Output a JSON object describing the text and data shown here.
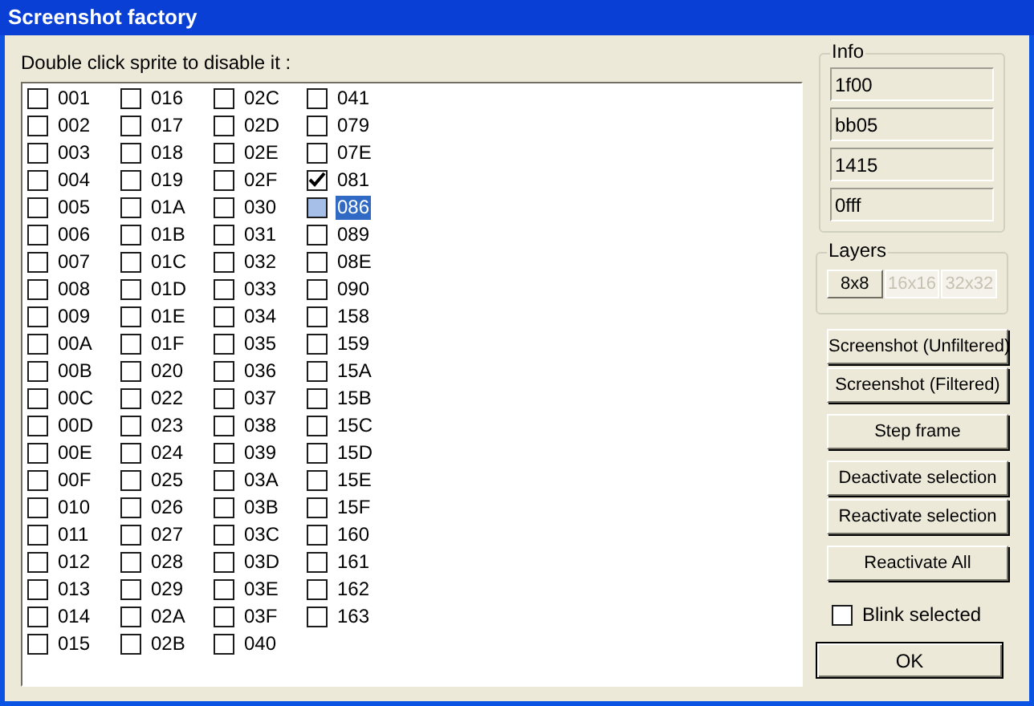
{
  "window": {
    "title": "Screenshot factory"
  },
  "instruction": "Double click sprite to disable it :",
  "sprites": [
    {
      "label": "001",
      "checked": false,
      "selected": false
    },
    {
      "label": "002",
      "checked": false,
      "selected": false
    },
    {
      "label": "003",
      "checked": false,
      "selected": false
    },
    {
      "label": "004",
      "checked": false,
      "selected": false
    },
    {
      "label": "005",
      "checked": false,
      "selected": false
    },
    {
      "label": "006",
      "checked": false,
      "selected": false
    },
    {
      "label": "007",
      "checked": false,
      "selected": false
    },
    {
      "label": "008",
      "checked": false,
      "selected": false
    },
    {
      "label": "009",
      "checked": false,
      "selected": false
    },
    {
      "label": "00A",
      "checked": false,
      "selected": false
    },
    {
      "label": "00B",
      "checked": false,
      "selected": false
    },
    {
      "label": "00C",
      "checked": false,
      "selected": false
    },
    {
      "label": "00D",
      "checked": false,
      "selected": false
    },
    {
      "label": "00E",
      "checked": false,
      "selected": false
    },
    {
      "label": "00F",
      "checked": false,
      "selected": false
    },
    {
      "label": "010",
      "checked": false,
      "selected": false
    },
    {
      "label": "011",
      "checked": false,
      "selected": false
    },
    {
      "label": "012",
      "checked": false,
      "selected": false
    },
    {
      "label": "013",
      "checked": false,
      "selected": false
    },
    {
      "label": "014",
      "checked": false,
      "selected": false
    },
    {
      "label": "015",
      "checked": false,
      "selected": false
    },
    {
      "label": "016",
      "checked": false,
      "selected": false
    },
    {
      "label": "017",
      "checked": false,
      "selected": false
    },
    {
      "label": "018",
      "checked": false,
      "selected": false
    },
    {
      "label": "019",
      "checked": false,
      "selected": false
    },
    {
      "label": "01A",
      "checked": false,
      "selected": false
    },
    {
      "label": "01B",
      "checked": false,
      "selected": false
    },
    {
      "label": "01C",
      "checked": false,
      "selected": false
    },
    {
      "label": "01D",
      "checked": false,
      "selected": false
    },
    {
      "label": "01E",
      "checked": false,
      "selected": false
    },
    {
      "label": "01F",
      "checked": false,
      "selected": false
    },
    {
      "label": "020",
      "checked": false,
      "selected": false
    },
    {
      "label": "022",
      "checked": false,
      "selected": false
    },
    {
      "label": "023",
      "checked": false,
      "selected": false
    },
    {
      "label": "024",
      "checked": false,
      "selected": false
    },
    {
      "label": "025",
      "checked": false,
      "selected": false
    },
    {
      "label": "026",
      "checked": false,
      "selected": false
    },
    {
      "label": "027",
      "checked": false,
      "selected": false
    },
    {
      "label": "028",
      "checked": false,
      "selected": false
    },
    {
      "label": "029",
      "checked": false,
      "selected": false
    },
    {
      "label": "02A",
      "checked": false,
      "selected": false
    },
    {
      "label": "02B",
      "checked": false,
      "selected": false
    },
    {
      "label": "02C",
      "checked": false,
      "selected": false
    },
    {
      "label": "02D",
      "checked": false,
      "selected": false
    },
    {
      "label": "02E",
      "checked": false,
      "selected": false
    },
    {
      "label": "02F",
      "checked": false,
      "selected": false
    },
    {
      "label": "030",
      "checked": false,
      "selected": false
    },
    {
      "label": "031",
      "checked": false,
      "selected": false
    },
    {
      "label": "032",
      "checked": false,
      "selected": false
    },
    {
      "label": "033",
      "checked": false,
      "selected": false
    },
    {
      "label": "034",
      "checked": false,
      "selected": false
    },
    {
      "label": "035",
      "checked": false,
      "selected": false
    },
    {
      "label": "036",
      "checked": false,
      "selected": false
    },
    {
      "label": "037",
      "checked": false,
      "selected": false
    },
    {
      "label": "038",
      "checked": false,
      "selected": false
    },
    {
      "label": "039",
      "checked": false,
      "selected": false
    },
    {
      "label": "03A",
      "checked": false,
      "selected": false
    },
    {
      "label": "03B",
      "checked": false,
      "selected": false
    },
    {
      "label": "03C",
      "checked": false,
      "selected": false
    },
    {
      "label": "03D",
      "checked": false,
      "selected": false
    },
    {
      "label": "03E",
      "checked": false,
      "selected": false
    },
    {
      "label": "03F",
      "checked": false,
      "selected": false
    },
    {
      "label": "040",
      "checked": false,
      "selected": false
    },
    {
      "label": "041",
      "checked": false,
      "selected": false
    },
    {
      "label": "079",
      "checked": false,
      "selected": false
    },
    {
      "label": "07E",
      "checked": false,
      "selected": false
    },
    {
      "label": "081",
      "checked": true,
      "selected": false
    },
    {
      "label": "086",
      "checked": false,
      "selected": true
    },
    {
      "label": "089",
      "checked": false,
      "selected": false
    },
    {
      "label": "08E",
      "checked": false,
      "selected": false
    },
    {
      "label": "090",
      "checked": false,
      "selected": false
    },
    {
      "label": "158",
      "checked": false,
      "selected": false
    },
    {
      "label": "159",
      "checked": false,
      "selected": false
    },
    {
      "label": "15A",
      "checked": false,
      "selected": false
    },
    {
      "label": "15B",
      "checked": false,
      "selected": false
    },
    {
      "label": "15C",
      "checked": false,
      "selected": false
    },
    {
      "label": "15D",
      "checked": false,
      "selected": false
    },
    {
      "label": "15E",
      "checked": false,
      "selected": false
    },
    {
      "label": "15F",
      "checked": false,
      "selected": false
    },
    {
      "label": "160",
      "checked": false,
      "selected": false
    },
    {
      "label": "161",
      "checked": false,
      "selected": false
    },
    {
      "label": "162",
      "checked": false,
      "selected": false
    },
    {
      "label": "163",
      "checked": false,
      "selected": false
    }
  ],
  "info": {
    "title": "Info",
    "fields": [
      "1f00",
      "bb05",
      "1415",
      "0fff"
    ]
  },
  "layers": {
    "title": "Layers",
    "buttons": [
      {
        "label": "8x8",
        "disabled": false
      },
      {
        "label": "16x16",
        "disabled": true
      },
      {
        "label": "32x32",
        "disabled": true
      }
    ]
  },
  "action_groups": [
    [
      "Screenshot (Unfiltered)",
      "Screenshot (Filtered)"
    ],
    [
      "Step frame"
    ],
    [
      "Deactivate selection",
      "Reactivate selection"
    ],
    [
      "Reactivate All"
    ]
  ],
  "blink": {
    "label": "Blink selected",
    "checked": false
  },
  "ok_button": "OK"
}
